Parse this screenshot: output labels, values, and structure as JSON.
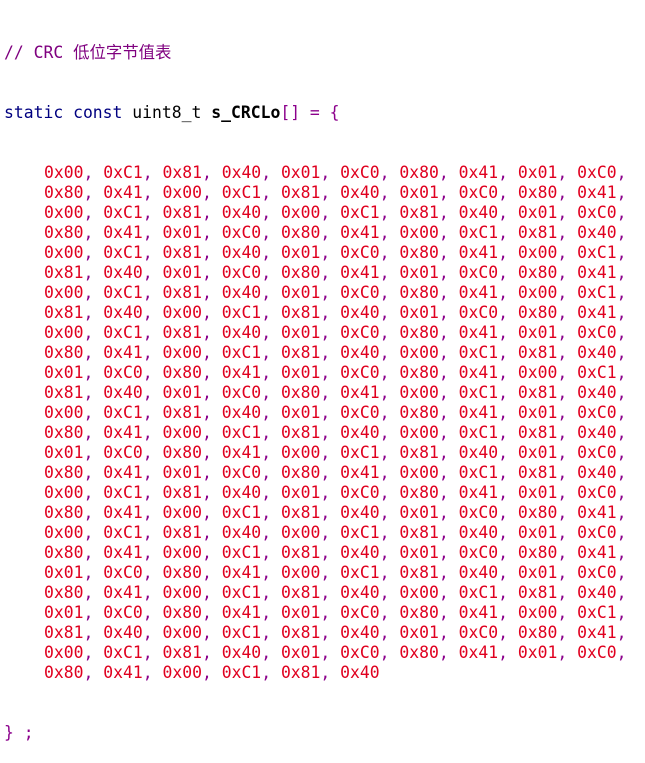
{
  "comment": "// CRC 低位字节值表",
  "declaration": {
    "keywords": "static const",
    "type": "uint8_t",
    "name": "s_CRCLo",
    "suffix": "[] = {"
  },
  "rows": [
    [
      "0x00",
      "0xC1",
      "0x81",
      "0x40",
      "0x01",
      "0xC0",
      "0x80",
      "0x41",
      "0x01",
      "0xC0"
    ],
    [
      "0x80",
      "0x41",
      "0x00",
      "0xC1",
      "0x81",
      "0x40",
      "0x01",
      "0xC0",
      "0x80",
      "0x41"
    ],
    [
      "0x00",
      "0xC1",
      "0x81",
      "0x40",
      "0x00",
      "0xC1",
      "0x81",
      "0x40",
      "0x01",
      "0xC0"
    ],
    [
      "0x80",
      "0x41",
      "0x01",
      "0xC0",
      "0x80",
      "0x41",
      "0x00",
      "0xC1",
      "0x81",
      "0x40"
    ],
    [
      "0x00",
      "0xC1",
      "0x81",
      "0x40",
      "0x01",
      "0xC0",
      "0x80",
      "0x41",
      "0x00",
      "0xC1"
    ],
    [
      "0x81",
      "0x40",
      "0x01",
      "0xC0",
      "0x80",
      "0x41",
      "0x01",
      "0xC0",
      "0x80",
      "0x41"
    ],
    [
      "0x00",
      "0xC1",
      "0x81",
      "0x40",
      "0x01",
      "0xC0",
      "0x80",
      "0x41",
      "0x00",
      "0xC1"
    ],
    [
      "0x81",
      "0x40",
      "0x00",
      "0xC1",
      "0x81",
      "0x40",
      "0x01",
      "0xC0",
      "0x80",
      "0x41"
    ],
    [
      "0x00",
      "0xC1",
      "0x81",
      "0x40",
      "0x01",
      "0xC0",
      "0x80",
      "0x41",
      "0x01",
      "0xC0"
    ],
    [
      "0x80",
      "0x41",
      "0x00",
      "0xC1",
      "0x81",
      "0x40",
      "0x00",
      "0xC1",
      "0x81",
      "0x40"
    ],
    [
      "0x01",
      "0xC0",
      "0x80",
      "0x41",
      "0x01",
      "0xC0",
      "0x80",
      "0x41",
      "0x00",
      "0xC1"
    ],
    [
      "0x81",
      "0x40",
      "0x01",
      "0xC0",
      "0x80",
      "0x41",
      "0x00",
      "0xC1",
      "0x81",
      "0x40"
    ],
    [
      "0x00",
      "0xC1",
      "0x81",
      "0x40",
      "0x01",
      "0xC0",
      "0x80",
      "0x41",
      "0x01",
      "0xC0"
    ],
    [
      "0x80",
      "0x41",
      "0x00",
      "0xC1",
      "0x81",
      "0x40",
      "0x00",
      "0xC1",
      "0x81",
      "0x40"
    ],
    [
      "0x01",
      "0xC0",
      "0x80",
      "0x41",
      "0x00",
      "0xC1",
      "0x81",
      "0x40",
      "0x01",
      "0xC0"
    ],
    [
      "0x80",
      "0x41",
      "0x01",
      "0xC0",
      "0x80",
      "0x41",
      "0x00",
      "0xC1",
      "0x81",
      "0x40"
    ],
    [
      "0x00",
      "0xC1",
      "0x81",
      "0x40",
      "0x01",
      "0xC0",
      "0x80",
      "0x41",
      "0x01",
      "0xC0"
    ],
    [
      "0x80",
      "0x41",
      "0x00",
      "0xC1",
      "0x81",
      "0x40",
      "0x01",
      "0xC0",
      "0x80",
      "0x41"
    ],
    [
      "0x00",
      "0xC1",
      "0x81",
      "0x40",
      "0x00",
      "0xC1",
      "0x81",
      "0x40",
      "0x01",
      "0xC0"
    ],
    [
      "0x80",
      "0x41",
      "0x00",
      "0xC1",
      "0x81",
      "0x40",
      "0x01",
      "0xC0",
      "0x80",
      "0x41"
    ],
    [
      "0x01",
      "0xC0",
      "0x80",
      "0x41",
      "0x00",
      "0xC1",
      "0x81",
      "0x40",
      "0x01",
      "0xC0"
    ],
    [
      "0x80",
      "0x41",
      "0x00",
      "0xC1",
      "0x81",
      "0x40",
      "0x00",
      "0xC1",
      "0x81",
      "0x40"
    ],
    [
      "0x01",
      "0xC0",
      "0x80",
      "0x41",
      "0x01",
      "0xC0",
      "0x80",
      "0x41",
      "0x00",
      "0xC1"
    ],
    [
      "0x81",
      "0x40",
      "0x00",
      "0xC1",
      "0x81",
      "0x40",
      "0x01",
      "0xC0",
      "0x80",
      "0x41"
    ],
    [
      "0x00",
      "0xC1",
      "0x81",
      "0x40",
      "0x01",
      "0xC0",
      "0x80",
      "0x41",
      "0x01",
      "0xC0"
    ],
    [
      "0x80",
      "0x41",
      "0x00",
      "0xC1",
      "0x81",
      "0x40"
    ]
  ],
  "closing": "} ;",
  "colors": {
    "comment": "#7f007f",
    "keyword": "#000080",
    "number": "#e0001f",
    "punctuation": "#8b008b",
    "background": "#ffffff"
  }
}
